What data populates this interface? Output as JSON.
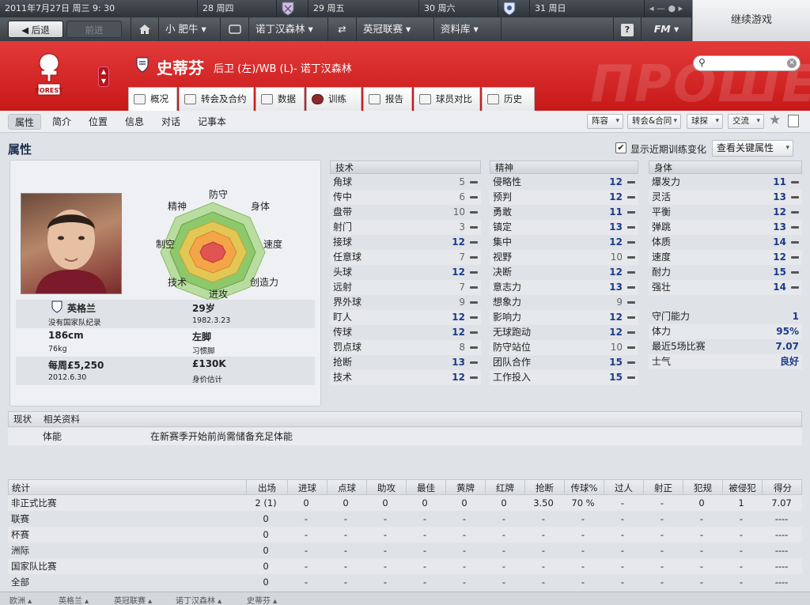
{
  "topbar": {
    "date": "2011年7月27日 周三  9: 30",
    "days": [
      "28 周四",
      "29 周五",
      "30 周六",
      "31 周日"
    ],
    "continue_label": "继续游戏"
  },
  "nav": {
    "back": "后退",
    "forward": "前进",
    "manager": "小 肥牛",
    "club": "诺丁汉森林",
    "league": "英冠联赛",
    "database": "资料库",
    "help": "?",
    "fm": "FM"
  },
  "player": {
    "name": "史蒂芬",
    "subtitle": "后卫 (左)/WB (L)- 诺丁汉森林",
    "club_badge_text": "FOREST",
    "bg_word": "ПРОШЕ"
  },
  "tabs": [
    "概况",
    "转会及合约",
    "数据",
    "训练",
    "报告",
    "球员对比",
    "历史"
  ],
  "subnav": {
    "items": [
      "属性",
      "简介",
      "位置",
      "信息",
      "对话",
      "记事本"
    ],
    "dropdowns": [
      "阵容",
      "转会&合同",
      "球探",
      "交流"
    ]
  },
  "section": {
    "title": "属性",
    "show_training": "显示近期训练变化",
    "key_attr_btn": "查看关键属性"
  },
  "radar_labels": {
    "top": "防守",
    "top_right": "身体",
    "right": "速度",
    "bottom_right": "创造力",
    "bottom": "进攻",
    "bottom_left": "技术",
    "left": "制空",
    "top_left": "精神"
  },
  "profile": {
    "nation": "英格兰",
    "nation_sub": "没有国家队纪录",
    "age": "29岁",
    "dob": "1982.3.23",
    "height": "186cm",
    "weight": "76kg",
    "foot": "左脚",
    "foot_sub": "习惯脚",
    "wage": "每周£5,250",
    "contract": "2012.6.30",
    "value": "£130K",
    "value_sub": "身价估计"
  },
  "technical": {
    "header": "技术",
    "rows": [
      {
        "label": "角球",
        "value": "5"
      },
      {
        "label": "传中",
        "value": "6"
      },
      {
        "label": "盘带",
        "value": "10"
      },
      {
        "label": "射门",
        "value": "3"
      },
      {
        "label": "接球",
        "value": "12"
      },
      {
        "label": "任意球",
        "value": "7"
      },
      {
        "label": "头球",
        "value": "12"
      },
      {
        "label": "远射",
        "value": "7"
      },
      {
        "label": "界外球",
        "value": "9"
      },
      {
        "label": "盯人",
        "value": "12"
      },
      {
        "label": "传球",
        "value": "12"
      },
      {
        "label": "罚点球",
        "value": "8"
      },
      {
        "label": "抢断",
        "value": "13"
      },
      {
        "label": "技术",
        "value": "12"
      }
    ]
  },
  "mental": {
    "header": "精神",
    "rows": [
      {
        "label": "侵略性",
        "value": "12"
      },
      {
        "label": "预判",
        "value": "12"
      },
      {
        "label": "勇敢",
        "value": "11"
      },
      {
        "label": "镇定",
        "value": "13"
      },
      {
        "label": "集中",
        "value": "12"
      },
      {
        "label": "视野",
        "value": "10"
      },
      {
        "label": "决断",
        "value": "12"
      },
      {
        "label": "意志力",
        "value": "13"
      },
      {
        "label": "想象力",
        "value": "9"
      },
      {
        "label": "影响力",
        "value": "12"
      },
      {
        "label": "无球跑动",
        "value": "12"
      },
      {
        "label": "防守站位",
        "value": "10"
      },
      {
        "label": "团队合作",
        "value": "15"
      },
      {
        "label": "工作投入",
        "value": "15"
      }
    ]
  },
  "physical": {
    "header": "身体",
    "rows": [
      {
        "label": "爆发力",
        "value": "11"
      },
      {
        "label": "灵活",
        "value": "13"
      },
      {
        "label": "平衡",
        "value": "12"
      },
      {
        "label": "弹跳",
        "value": "13"
      },
      {
        "label": "体质",
        "value": "14"
      },
      {
        "label": "速度",
        "value": "12"
      },
      {
        "label": "耐力",
        "value": "15"
      },
      {
        "label": "强壮",
        "value": "14"
      }
    ]
  },
  "extra": [
    {
      "label": "守门能力",
      "value": "1"
    },
    {
      "label": "体力",
      "value": "95%"
    },
    {
      "label": "最近5场比赛",
      "value": "7.07"
    },
    {
      "label": "士气",
      "value": "良好"
    }
  ],
  "status": {
    "col1": "现状",
    "col2": "相关资料",
    "row_label": "体能",
    "row_text": "在新赛季开始前尚需储备充足体能"
  },
  "stats": {
    "headers": [
      "统计",
      "出场",
      "进球",
      "点球",
      "助攻",
      "最佳",
      "黄牌",
      "红牌",
      "抢断",
      "传球%",
      "过人",
      "射正",
      "犯规",
      "被侵犯",
      "得分"
    ],
    "rows": [
      [
        "非正式比赛",
        "2 (1)",
        "0",
        "0",
        "0",
        "0",
        "0",
        "0",
        "3.50",
        "70 %",
        "-",
        "-",
        "0",
        "1",
        "7.07"
      ],
      [
        "联赛",
        "0",
        "-",
        "-",
        "-",
        "-",
        "-",
        "-",
        "-",
        "-",
        "-",
        "-",
        "-",
        "-",
        "----"
      ],
      [
        "杯赛",
        "0",
        "-",
        "-",
        "-",
        "-",
        "-",
        "-",
        "-",
        "-",
        "-",
        "-",
        "-",
        "-",
        "----"
      ],
      [
        "洲际",
        "0",
        "-",
        "-",
        "-",
        "-",
        "-",
        "-",
        "-",
        "-",
        "-",
        "-",
        "-",
        "-",
        "----"
      ],
      [
        "国家队比赛",
        "0",
        "-",
        "-",
        "-",
        "-",
        "-",
        "-",
        "-",
        "-",
        "-",
        "-",
        "-",
        "-",
        "----"
      ],
      [
        "全部",
        "0",
        "-",
        "-",
        "-",
        "-",
        "-",
        "-",
        "-",
        "-",
        "-",
        "-",
        "-",
        "-",
        "----"
      ]
    ]
  },
  "breadcrumbs": [
    "欧洲",
    "英格兰",
    "英冠联赛",
    "诺丁汉森林",
    "史蒂芬"
  ]
}
